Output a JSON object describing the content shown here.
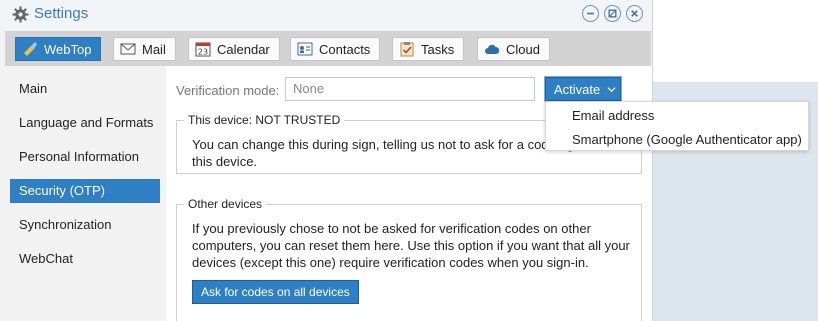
{
  "window": {
    "title": "Settings",
    "title_icon": "gear-icon",
    "controls": [
      "minimize-icon",
      "maximize-icon",
      "close-icon"
    ]
  },
  "toolbar": {
    "tabs": [
      {
        "label": "WebTop",
        "icon": "webtop-icon",
        "active": true
      },
      {
        "label": "Mail",
        "icon": "mail-icon",
        "active": false
      },
      {
        "label": "Calendar",
        "icon": "calendar-icon",
        "active": false
      },
      {
        "label": "Contacts",
        "icon": "contacts-icon",
        "active": false
      },
      {
        "label": "Tasks",
        "icon": "tasks-icon",
        "active": false
      },
      {
        "label": "Cloud",
        "icon": "cloud-icon",
        "active": false
      }
    ],
    "calendar_day": "23"
  },
  "sidebar": {
    "items": [
      {
        "label": "Main",
        "selected": false
      },
      {
        "label": "Language and Formats",
        "selected": false
      },
      {
        "label": "Personal Information",
        "selected": false
      },
      {
        "label": "Security (OTP)",
        "selected": true
      },
      {
        "label": "Synchronization",
        "selected": false
      },
      {
        "label": "WebChat",
        "selected": false
      }
    ]
  },
  "main": {
    "verification": {
      "label": "Verification mode:",
      "value": "None",
      "activate_label": "Activate"
    },
    "this_device": {
      "legend": "This device: NOT TRUSTED",
      "text": "You can change this during sign, telling us not to ask for a code again on this device."
    },
    "other_devices": {
      "legend": "Other devices",
      "text": "If you previously chose to not be asked for verification codes on other computers, you can reset them here. Use this option if you want that all your devices (except this one) require verification codes when you sign-in.",
      "button_label": "Ask for codes on all devices"
    }
  },
  "activate_menu": {
    "items": [
      {
        "label": "Email address"
      },
      {
        "label": "Smartphone (Google Authenticator app)"
      }
    ]
  },
  "colors": {
    "accent": "#2f7fc4",
    "title_text": "#3d7ab8",
    "toolbar_bg": "#d3d3d3",
    "panel_bg": "#f2f2f2"
  }
}
